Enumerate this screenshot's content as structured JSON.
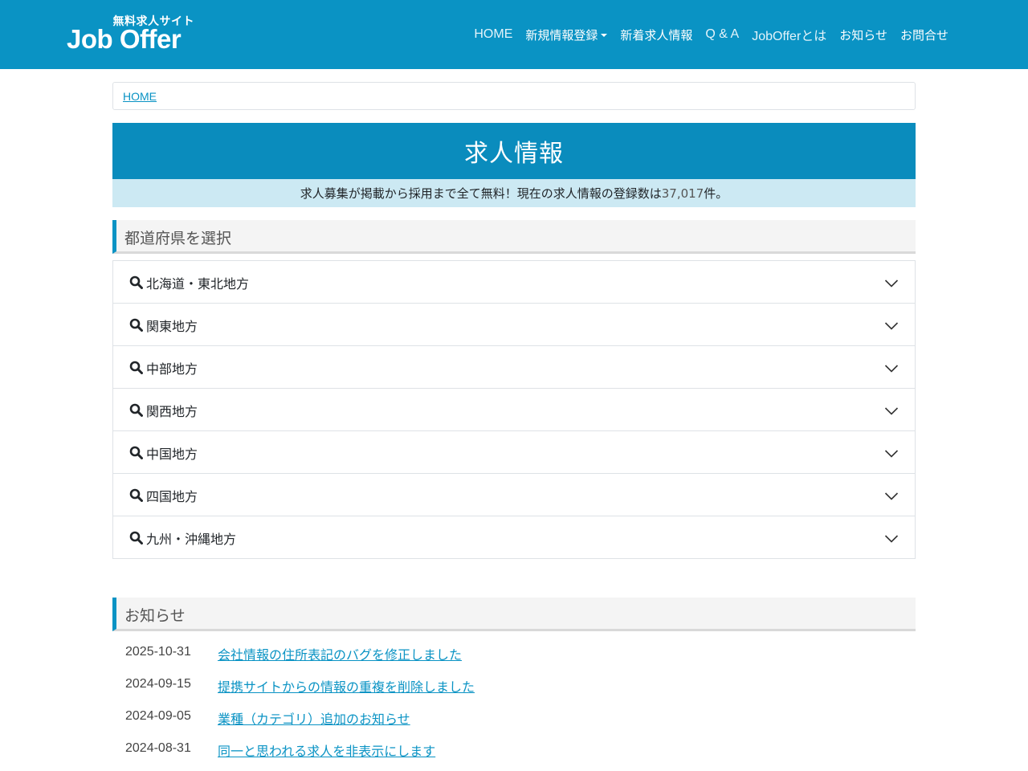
{
  "header": {
    "logo_sub": "無料求人サイト",
    "logo_main": "Job Offer",
    "nav": [
      {
        "label": "HOME",
        "light": true
      },
      {
        "label": "新規情報登録",
        "dropdown": true
      },
      {
        "label": "新着求人情報"
      },
      {
        "label": "Q & A",
        "light": true
      },
      {
        "label": "JobOfferとは",
        "light": true
      },
      {
        "label": "お知らせ"
      },
      {
        "label": "お問合せ"
      }
    ]
  },
  "breadcrumb": {
    "home": "HOME"
  },
  "hero": {
    "title": "求人情報",
    "sub_before": "求人募集が掲載から採用まで全て無料！現在の求人情報の登録数は",
    "count": "37,017",
    "sub_after": "件。"
  },
  "prefecture": {
    "heading": "都道府県を選択",
    "regions": [
      "北海道・東北地方",
      "関東地方",
      "中部地方",
      "関西地方",
      "中国地方",
      "四国地方",
      "九州・沖縄地方"
    ]
  },
  "news": {
    "heading": "お知らせ",
    "items": [
      {
        "date": "2025-10-31",
        "title": "会社情報の住所表記のバグを修正しました"
      },
      {
        "date": "2024-09-15",
        "title": "提携サイトからの情報の重複を削除しました"
      },
      {
        "date": "2024-09-05",
        "title": "業種（カテゴリ）追加のお知らせ"
      },
      {
        "date": "2024-08-31",
        "title": "同一と思われる求人を非表示にします"
      }
    ]
  },
  "colors": {
    "brand": "#0a93c4",
    "hero_sub_bg": "#cce9f3"
  },
  "icons": {
    "search": "search-icon",
    "chevron": "chevron-down-icon",
    "caret": "caret-down-icon"
  }
}
